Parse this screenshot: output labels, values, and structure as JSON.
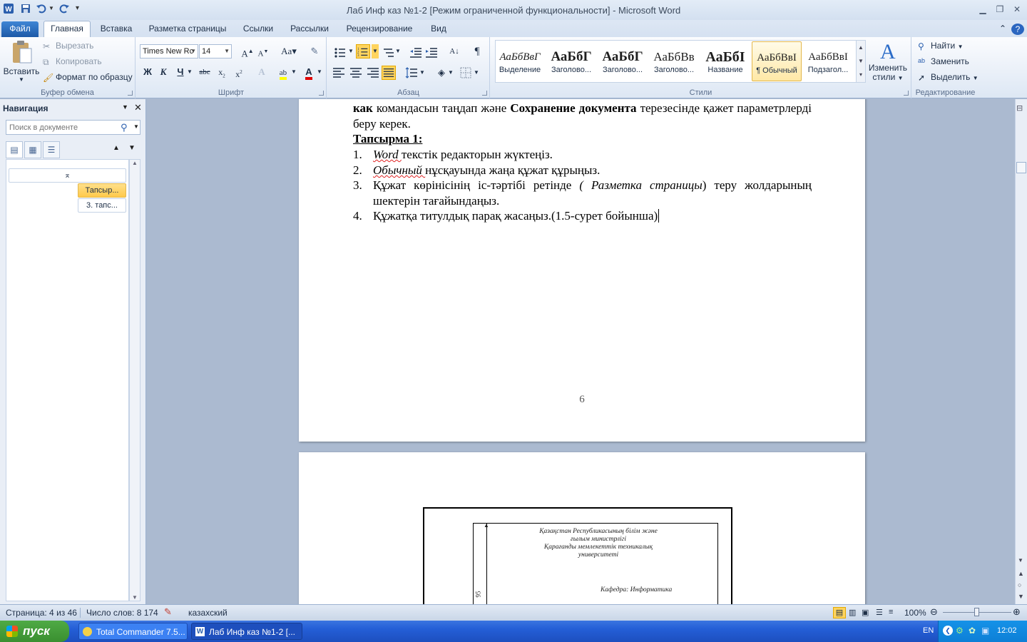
{
  "window": {
    "title": "Лаб Инф каз №1-2 [Режим ограниченной функциональности]  -  Microsoft Word"
  },
  "tabs": [
    {
      "label": "Файл"
    },
    {
      "label": "Главная"
    },
    {
      "label": "Вставка"
    },
    {
      "label": "Разметка страницы"
    },
    {
      "label": "Ссылки"
    },
    {
      "label": "Рассылки"
    },
    {
      "label": "Рецензирование"
    },
    {
      "label": "Вид"
    }
  ],
  "ribbon": {
    "clipboard": {
      "label": "Буфер обмена",
      "paste": "Вставить",
      "cut": "Вырезать",
      "copy": "Копировать",
      "format_painter": "Формат по образцу"
    },
    "font": {
      "label": "Шрифт",
      "family": "Times New Rc",
      "size": "14",
      "bold": "Ж",
      "italic": "К",
      "underline": "Ч"
    },
    "paragraph": {
      "label": "Абзац"
    },
    "styles": {
      "label": "Стили",
      "items": [
        {
          "sample": "АаБбВвГ",
          "name": "Выделение"
        },
        {
          "sample": "АаБбГ",
          "name": "Заголово..."
        },
        {
          "sample": "АаБбГ",
          "name": "Заголово..."
        },
        {
          "sample": "АаБбВв",
          "name": "Заголово..."
        },
        {
          "sample": "АаБбІ",
          "name": "Название"
        },
        {
          "sample": "АаБбВвІ",
          "name": "¶ Обычный"
        },
        {
          "sample": "АаБбВвІ",
          "name": "Подзагол..."
        }
      ],
      "change_styles_line1": "Изменить",
      "change_styles_line2": "стили"
    },
    "editing": {
      "label": "Редактирование",
      "find": "Найти",
      "replace": "Заменить",
      "select": "Выделить"
    }
  },
  "nav": {
    "title": "Навигация",
    "search_placeholder": "Поиск в документе",
    "headings": [
      "Тапсыр...",
      "3. тапс..."
    ]
  },
  "document": {
    "p1_part1": "как",
    "p1_part2": " командасын таңдап және ",
    "p1_part3": "Сохранение документа",
    "p1_part4": " терезесінде қажет параметрлерді беру керек.",
    "task_heading": "Тапсырма 1:",
    "list": [
      {
        "num": "1.",
        "em": "Word ",
        "text": "текстік редакторын жүктеңіз."
      },
      {
        "num": "2.",
        "em": "Обычный ",
        "text": "нұсқауында жаңа құжат құрыңыз."
      },
      {
        "num": "3.",
        "text_a": "Құжат көрінісінің іс-тәртібі ретінде ",
        "em": "( Разметка страницы",
        "text_b": ") теру жолдарының шектерін тағайындаңыз."
      },
      {
        "num": "4.",
        "text": "Құжатқа титулдық парақ жасаңыз.(1.5-сурет бойынша)"
      }
    ],
    "page_number": "6",
    "title_page": {
      "line1": "Қазақстан Республикасының білім және",
      "line2": "ғылым министрлігі",
      "line3": "Қарағанды мемлекеттік техникалық",
      "line4": "университеті",
      "dept": "Кафедра: Информатика",
      "dim": "95"
    }
  },
  "status": {
    "page": "Страница: 4 из 46",
    "words": "Число слов: 8 174",
    "language": "казахский",
    "zoom": "100%"
  },
  "taskbar": {
    "start": "пуск",
    "items": [
      "Total Commander 7.5...",
      "Лаб Инф каз №1-2 [..."
    ],
    "lang": "EN",
    "clock": "12:02"
  },
  "colors": {
    "accent": "#2b579a",
    "selected_style": "#ffe8a6",
    "taskbar": "#245ed6",
    "start": "#3a8f30"
  }
}
